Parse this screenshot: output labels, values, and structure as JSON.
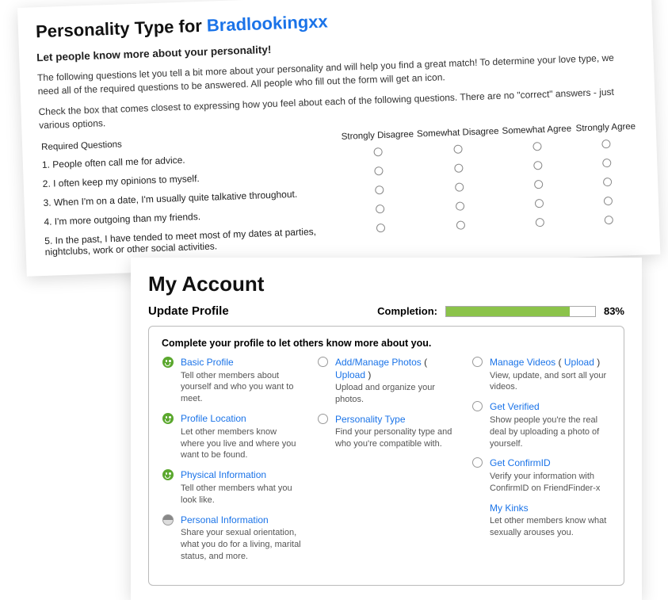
{
  "personality": {
    "title_prefix": "Personality Type for ",
    "username": "Bradlookingxx",
    "subtitle": "Let people know more about your personality!",
    "para1": "The following questions let you tell a bit more about your personality and will help you find a great match! To determine your love type, we need all of the required questions to be answered. All people who fill out the form will get an icon.",
    "para2": "Check the box that comes closest to expressing how you feel about each of the following questions. There are no \"correct\" answers - just various options.",
    "table": {
      "req_header": "Required Questions",
      "columns": [
        "Strongly Disagree",
        "Somewhat Disagree",
        "Somewhat Agree",
        "Strongly Agree"
      ],
      "questions": [
        "1. People often call me for advice.",
        "2. I often keep my opinions to myself.",
        "3. When I'm on a date, I'm usually quite talkative throughout.",
        "4. I'm more outgoing than my friends.",
        "5. In the past, I have tended to meet most of my dates at parties, nightclubs, work or other social activities."
      ]
    }
  },
  "account": {
    "title": "My Account",
    "update_label": "Update Profile",
    "completion_label": "Completion:",
    "completion_pct": "83%",
    "completion_value": 83,
    "box_intro": "Complete your profile to let others know more about you.",
    "col1": [
      {
        "status": "done",
        "title": "Basic Profile",
        "desc": "Tell other members about yourself and who you want to meet."
      },
      {
        "status": "done",
        "title": "Profile Location",
        "desc": "Let other members know where you live and where you want to be found."
      },
      {
        "status": "done",
        "title": "Physical Information",
        "desc": "Tell other members what you look like."
      },
      {
        "status": "partial",
        "title": "Personal Information",
        "desc": "Share your sexual orientation, what you do for a living, marital status, and more."
      }
    ],
    "col2": [
      {
        "status": "empty",
        "title": "Add/Manage Photos",
        "extra": "Upload",
        "desc": "Upload and organize your photos."
      },
      {
        "status": "empty",
        "title": "Personality Type",
        "desc": "Find your personality type and who you're compatible with."
      }
    ],
    "col3": [
      {
        "status": "empty",
        "title": "Manage Videos",
        "extra": "Upload",
        "desc": "View, update, and sort all your videos."
      },
      {
        "status": "empty",
        "title": "Get Verified",
        "desc": "Show people you're the real deal by uploading a photo of yourself."
      },
      {
        "status": "empty",
        "title": "Get ConfirmID",
        "desc": "Verify your information with ConfirmID on FriendFinder-x"
      },
      {
        "status": "none",
        "title": "My Kinks",
        "desc": "Let other members know what sexually arouses you."
      }
    ]
  }
}
